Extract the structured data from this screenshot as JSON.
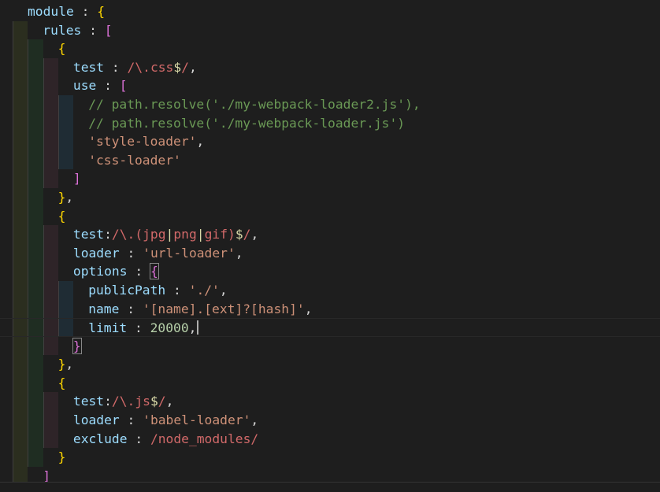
{
  "editor": {
    "lines": [
      {
        "indent": 0,
        "tokens": [
          {
            "t": "module",
            "c": "kw"
          },
          {
            "t": " : ",
            "c": "pn"
          },
          {
            "t": "{",
            "c": "b1"
          }
        ]
      },
      {
        "indent": 1,
        "tokens": [
          {
            "t": "rules",
            "c": "kw"
          },
          {
            "t": " : ",
            "c": "pn"
          },
          {
            "t": "[",
            "c": "b2"
          }
        ]
      },
      {
        "indent": 2,
        "tokens": [
          {
            "t": "{",
            "c": "b1"
          }
        ]
      },
      {
        "indent": 3,
        "tokens": [
          {
            "t": "test",
            "c": "kw"
          },
          {
            "t": " : ",
            "c": "pn"
          },
          {
            "t": "/\\.css",
            "c": "rx"
          },
          {
            "t": "$",
            "c": "ro"
          },
          {
            "t": "/",
            "c": "rx"
          },
          {
            "t": ",",
            "c": "pn"
          }
        ]
      },
      {
        "indent": 3,
        "tokens": [
          {
            "t": "use",
            "c": "kw"
          },
          {
            "t": " : ",
            "c": "pn"
          },
          {
            "t": "[",
            "c": "b2"
          }
        ]
      },
      {
        "indent": 4,
        "tokens": [
          {
            "t": "// path.resolve('./my-webpack-loader2.js'),",
            "c": "cm"
          }
        ]
      },
      {
        "indent": 4,
        "tokens": [
          {
            "t": "// path.resolve('./my-webpack-loader.js')",
            "c": "cm"
          }
        ]
      },
      {
        "indent": 4,
        "tokens": [
          {
            "t": "'style-loader'",
            "c": "st"
          },
          {
            "t": ",",
            "c": "pn"
          }
        ]
      },
      {
        "indent": 4,
        "tokens": [
          {
            "t": "'css-loader'",
            "c": "st"
          }
        ]
      },
      {
        "indent": 3,
        "tokens": [
          {
            "t": "]",
            "c": "b2"
          }
        ]
      },
      {
        "indent": 2,
        "tokens": [
          {
            "t": "}",
            "c": "b1"
          },
          {
            "t": ",",
            "c": "pn"
          }
        ]
      },
      {
        "indent": 2,
        "tokens": [
          {
            "t": "{",
            "c": "b1"
          }
        ]
      },
      {
        "indent": 3,
        "tokens": [
          {
            "t": "test",
            "c": "kw"
          },
          {
            "t": ":",
            "c": "pn"
          },
          {
            "t": "/\\.(jpg",
            "c": "rx"
          },
          {
            "t": "|",
            "c": "ro"
          },
          {
            "t": "png",
            "c": "rx"
          },
          {
            "t": "|",
            "c": "ro"
          },
          {
            "t": "gif)",
            "c": "rx"
          },
          {
            "t": "$",
            "c": "ro"
          },
          {
            "t": "/",
            "c": "rx"
          },
          {
            "t": ",",
            "c": "pn"
          }
        ]
      },
      {
        "indent": 3,
        "tokens": [
          {
            "t": "loader",
            "c": "kw"
          },
          {
            "t": " : ",
            "c": "pn"
          },
          {
            "t": "'url-loader'",
            "c": "st"
          },
          {
            "t": ",",
            "c": "pn"
          }
        ]
      },
      {
        "indent": 3,
        "tokens": [
          {
            "t": "options",
            "c": "kw"
          },
          {
            "t": " : ",
            "c": "pn"
          },
          {
            "t": "{",
            "c": "b2",
            "m": true
          }
        ]
      },
      {
        "indent": 4,
        "tokens": [
          {
            "t": "publicPath",
            "c": "kw"
          },
          {
            "t": " : ",
            "c": "pn"
          },
          {
            "t": "'./'",
            "c": "st"
          },
          {
            "t": ",",
            "c": "pn"
          }
        ]
      },
      {
        "indent": 4,
        "tokens": [
          {
            "t": "name",
            "c": "kw"
          },
          {
            "t": " : ",
            "c": "pn"
          },
          {
            "t": "'[name].[ext]?[hash]'",
            "c": "st"
          },
          {
            "t": ",",
            "c": "pn"
          }
        ]
      },
      {
        "indent": 4,
        "current": true,
        "tokens": [
          {
            "t": "limit",
            "c": "kw"
          },
          {
            "t": " : ",
            "c": "pn"
          },
          {
            "t": "20000",
            "c": "nm"
          },
          {
            "t": ",",
            "c": "pn"
          },
          {
            "t": "",
            "c": "cursor"
          }
        ]
      },
      {
        "indent": 3,
        "tokens": [
          {
            "t": "}",
            "c": "b2",
            "m": true
          }
        ]
      },
      {
        "indent": 2,
        "tokens": [
          {
            "t": "}",
            "c": "b1"
          },
          {
            "t": ",",
            "c": "pn"
          }
        ]
      },
      {
        "indent": 2,
        "tokens": [
          {
            "t": "{",
            "c": "b1"
          }
        ]
      },
      {
        "indent": 3,
        "tokens": [
          {
            "t": "test",
            "c": "kw"
          },
          {
            "t": ":",
            "c": "pn"
          },
          {
            "t": "/\\.js",
            "c": "rx"
          },
          {
            "t": "$",
            "c": "ro"
          },
          {
            "t": "/",
            "c": "rx"
          },
          {
            "t": ",",
            "c": "pn"
          }
        ]
      },
      {
        "indent": 3,
        "tokens": [
          {
            "t": "loader",
            "c": "kw"
          },
          {
            "t": " : ",
            "c": "pn"
          },
          {
            "t": "'babel-loader'",
            "c": "st"
          },
          {
            "t": ",",
            "c": "pn"
          }
        ]
      },
      {
        "indent": 3,
        "tokens": [
          {
            "t": "exclude",
            "c": "kw"
          },
          {
            "t": " : ",
            "c": "pn"
          },
          {
            "t": "/node_modules/",
            "c": "rx"
          }
        ]
      },
      {
        "indent": 2,
        "tokens": [
          {
            "t": "}",
            "c": "b1"
          }
        ]
      },
      {
        "indent": 1,
        "tokens": [
          {
            "t": "]",
            "c": "b2"
          }
        ]
      }
    ]
  }
}
